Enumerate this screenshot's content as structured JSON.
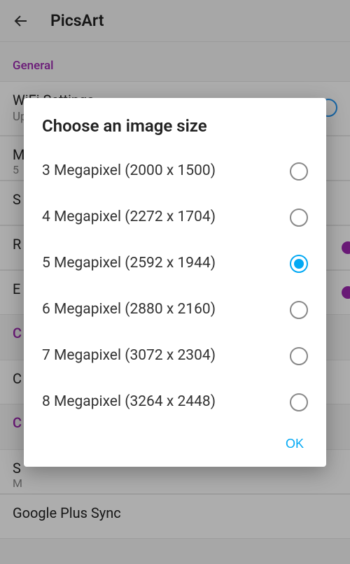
{
  "header": {
    "title": "PicsArt"
  },
  "section": {
    "general_label": "General"
  },
  "wifi": {
    "title": "WiFi Settings",
    "subtitle": "Upload only if WiFi is available."
  },
  "bg_rows": {
    "r1a": "M",
    "r1b": "5",
    "r2": "S",
    "r3": "R",
    "r4": "E",
    "r5": "C",
    "r6": "C",
    "r7": "C",
    "r8a": "S",
    "r8b": "M",
    "r9": "Google Plus Sync"
  },
  "dialog": {
    "title": "Choose an image size",
    "ok_label": "OK",
    "selected_index": 2,
    "options": [
      {
        "label": "3 Megapixel (2000 x 1500)"
      },
      {
        "label": "4 Megapixel (2272 x 1704)"
      },
      {
        "label": "5 Megapixel (2592 x 1944)"
      },
      {
        "label": "6 Megapixel (2880 x 2160)"
      },
      {
        "label": "7 Megapixel (3072 x 2304)"
      },
      {
        "label": "8 Megapixel (3264 x 2448)"
      }
    ]
  }
}
